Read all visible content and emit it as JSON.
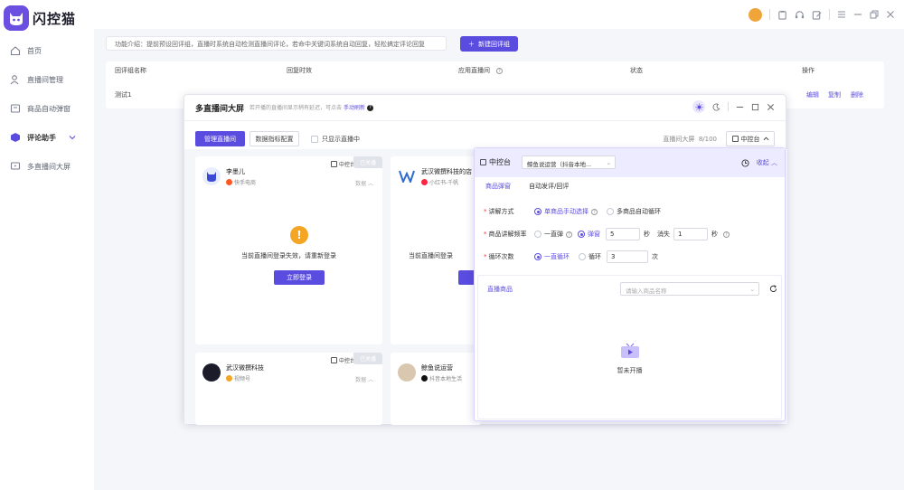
{
  "app": {
    "brand": "闪控猫"
  },
  "sidebar": {
    "items": [
      {
        "label": "首页"
      },
      {
        "label": "直播间管理"
      },
      {
        "label": "商品自动弹窗"
      },
      {
        "label": "评论助手"
      },
      {
        "label": "多直播间大屏"
      }
    ]
  },
  "intro": {
    "text": "功能介绍：提前预设回评组，直播时系统自动检测直播间评论，若命中关键词系统自动回复，轻松搞定评论回复"
  },
  "toolbar": {
    "new_group": "新建回评组"
  },
  "table": {
    "headers": [
      "回评组名称",
      "回复时效",
      "应用直播间",
      "状态",
      "操作"
    ],
    "rows": [
      {
        "name": "测试1",
        "ops": [
          "编辑",
          "复制",
          "删除"
        ]
      }
    ]
  },
  "window": {
    "title": "多直播间大屏",
    "subtitle": "若开播的直播间显示稍有延迟，可点击",
    "refresh": "手动刷新",
    "btn_manage": "管理直播间",
    "btn_metric": "数据指标配置",
    "only_live": "只显示直播中",
    "count_label": "直播间大屏",
    "count": "8/100",
    "ctl_button": "中控台",
    "cards": [
      {
        "name": "李墨儿",
        "platform": "快手电商",
        "ctl": "中控台",
        "status": "已关播",
        "data": "数据",
        "message": "当前直播间登录失效，请重新登录",
        "login": "立即登录"
      },
      {
        "name": "武汉微撰科技的店",
        "platform": "小红书-千帆",
        "message": "当前直播间登录"
      },
      {
        "name": "武汉微撰科技",
        "platform": "视频号",
        "ctl": "中控台",
        "status": "已关播",
        "data": "数据"
      },
      {
        "name": "鲸鱼说运营",
        "platform": "抖音本地生活"
      }
    ]
  },
  "panel": {
    "title": "中控台",
    "room": "鲸鱼说运营（抖音本地...",
    "collapse": "收起",
    "tabs": [
      "商品弹窗",
      "自动发评/回评"
    ],
    "mode_label": "讲解方式",
    "mode_options": [
      "单商品手动选择",
      "多商品自动循环"
    ],
    "freq_label": "商品讲解频率",
    "freq_options": [
      "一直弹",
      "弹窗"
    ],
    "popup_value": "5",
    "sec": "秒",
    "vanish": "消失",
    "vanish_value": "1",
    "loop_label": "循环次数",
    "loop_options": [
      "一直循环",
      "循环"
    ],
    "loop_value": "3",
    "times": "次",
    "goods_label": "直播商品",
    "goods_placeholder": "请输入商品名称",
    "empty_text": "暂未开播"
  },
  "colors": {
    "accent": "#5b4ce0",
    "warning": "#f5a524"
  }
}
